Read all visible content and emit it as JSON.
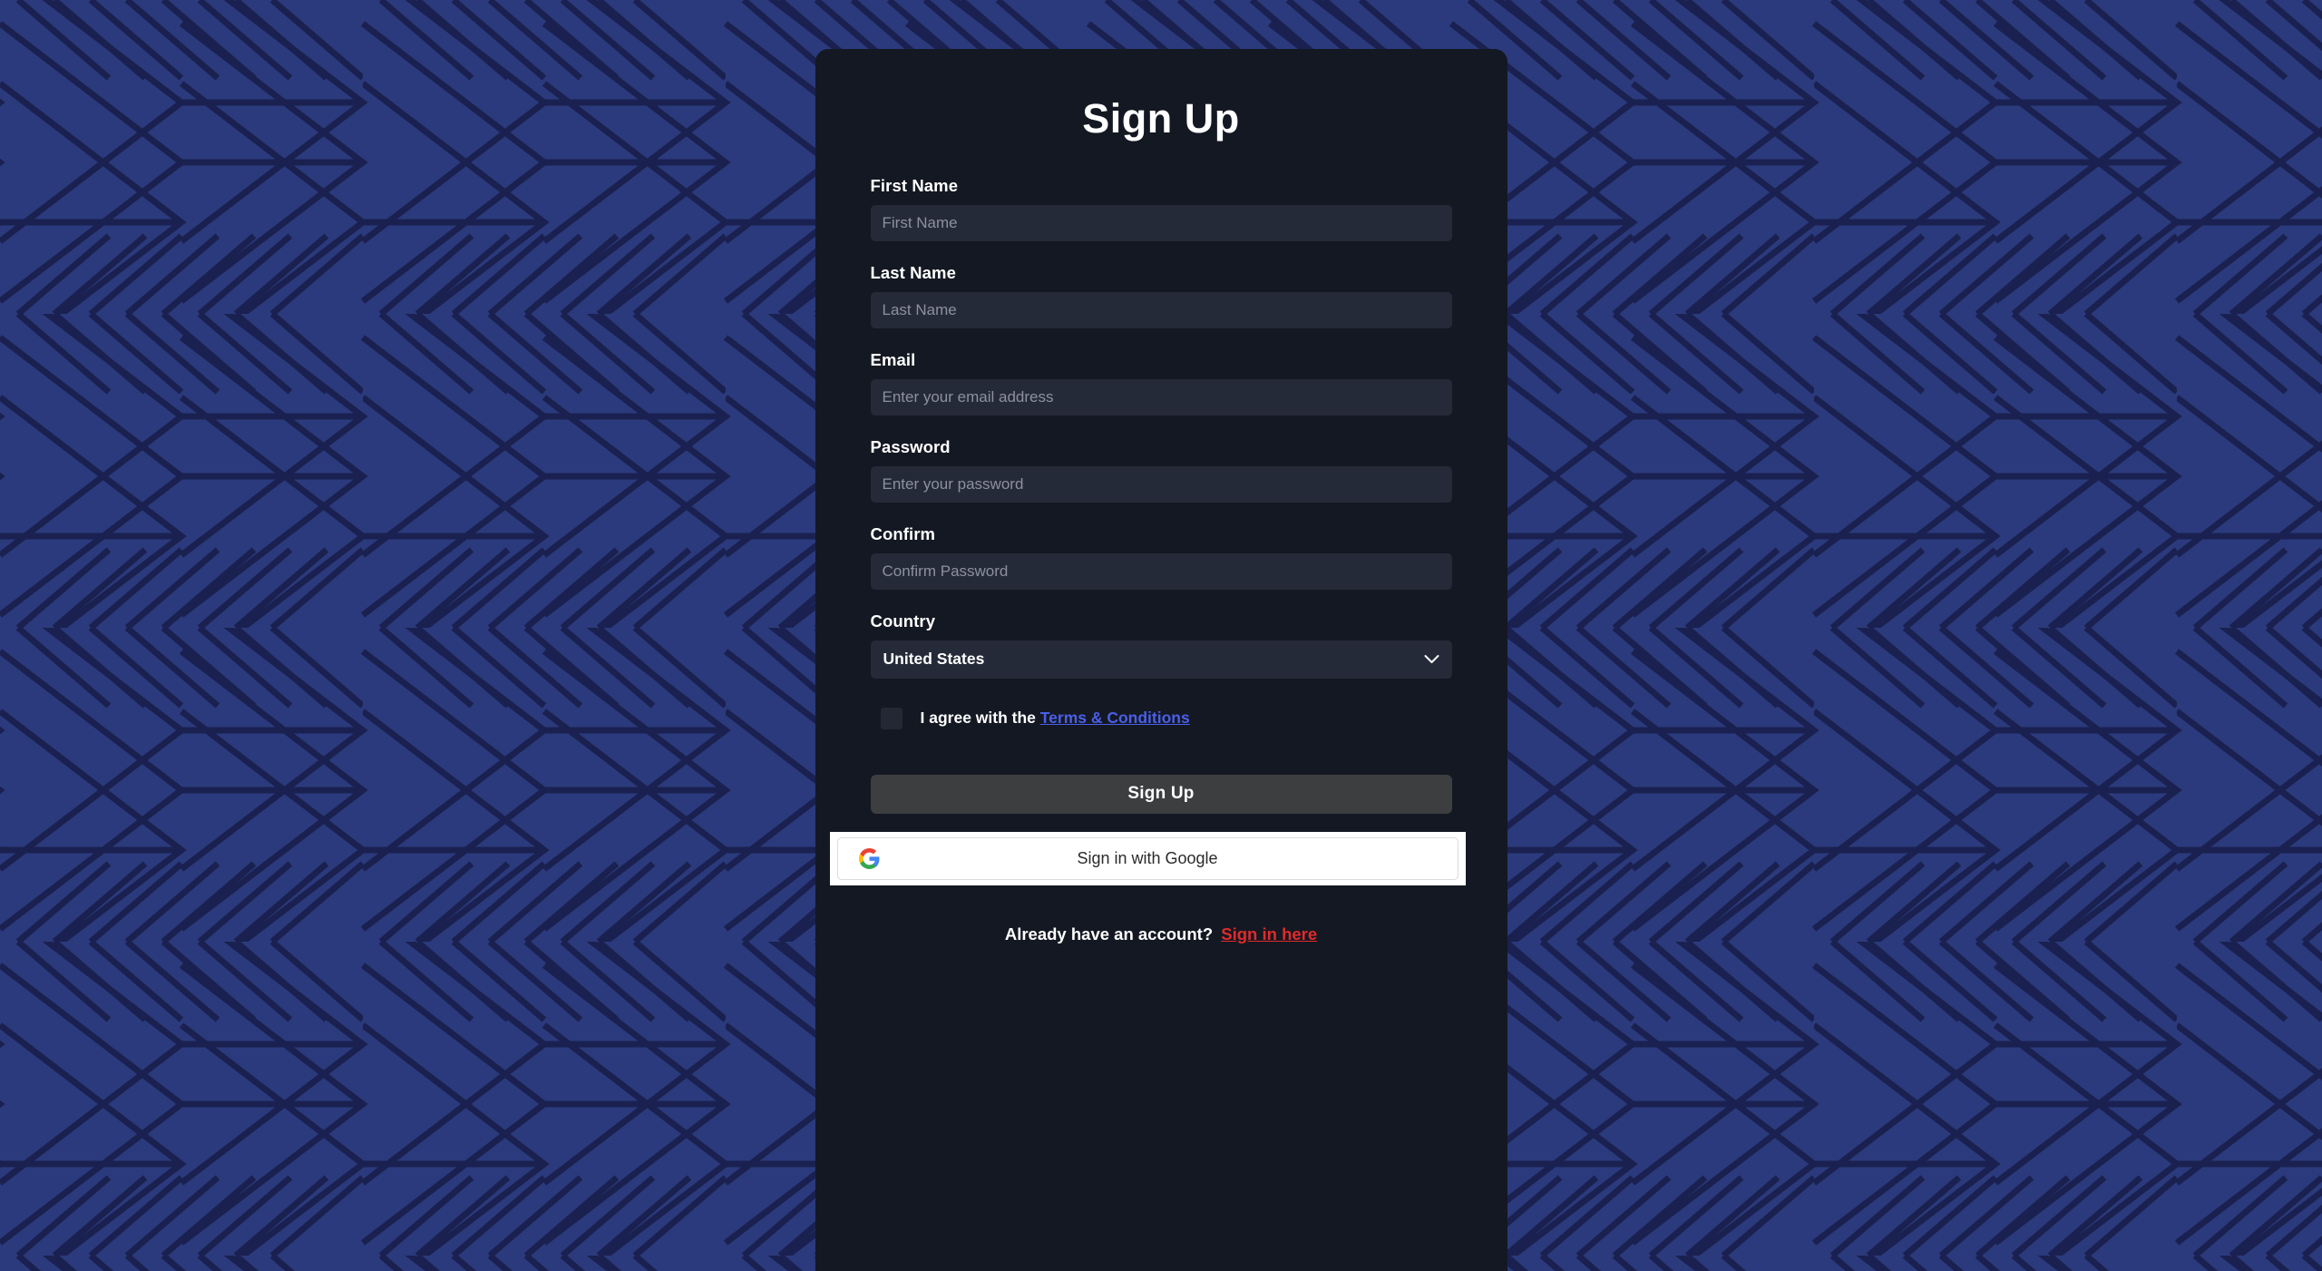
{
  "page": {
    "background_color": "#2b3a7c",
    "pattern_line_color": "#1a2150",
    "card_background": "#141822"
  },
  "card": {
    "title": "Sign Up"
  },
  "form": {
    "fields": [
      {
        "label": "First Name",
        "placeholder": "First Name",
        "value": "",
        "type": "text"
      },
      {
        "label": "Last Name",
        "placeholder": "Last Name",
        "value": "",
        "type": "text"
      },
      {
        "label": "Email",
        "placeholder": "Enter your email address",
        "value": "",
        "type": "email"
      },
      {
        "label": "Password",
        "placeholder": "Enter your password",
        "value": "",
        "type": "password"
      },
      {
        "label": "Confirm",
        "placeholder": "Confirm Password",
        "value": "",
        "type": "password"
      }
    ],
    "country": {
      "label": "Country",
      "selected": "United States",
      "options": [
        "United States"
      ]
    },
    "terms": {
      "checked": false,
      "text": "I agree with the",
      "link_label": "Terms & Conditions",
      "link_color": "#4a5fe8"
    }
  },
  "actions": {
    "submit_label": "Sign Up",
    "submit_color": "#3d3e40",
    "google_label": "Sign in with Google",
    "google_icon": "google-g-icon"
  },
  "footer": {
    "prompt": "Already have an account?",
    "link_label": "Sign in here",
    "link_color": "#e02b2b"
  },
  "icons": {
    "chevron_down": "chevron-down-icon",
    "checkbox": "checkbox-unchecked-icon"
  }
}
